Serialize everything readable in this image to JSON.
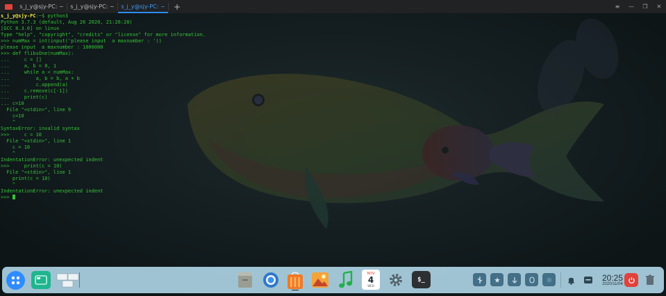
{
  "titlebar": {
    "tabs": [
      {
        "label": "s_j_y@sjy-PC: ~",
        "active": false
      },
      {
        "label": "s_j_y@sjy-PC: ~",
        "active": false
      },
      {
        "label": "s_j_y@sjy-PC: ~",
        "active": true
      }
    ],
    "add_tab": "+",
    "menu_icon": "≡",
    "minimize_icon": "—",
    "maximize_icon": "❐",
    "close_icon": "✕"
  },
  "terminal": {
    "prompt_user": "s_j_y@sjy-PC",
    "prompt_rest": ":~$ python3",
    "lines": [
      "Python 3.7.3 (default, Aug 26 2020, 21:26:28)",
      "[GCC 8.3.0] on linux",
      "Type \"help\", \"copyright\", \"credits\" or \"license\" for more information.",
      ">>> numMax = int(input('please input  a maxnumber : '))",
      "please input  a maxnumber : 1000000",
      ">>> def flibsOne(numMax):",
      "...     c = []",
      "...     a, b = 0, 1",
      "...     while a < numMax:",
      "...         a, b = b, a + b",
      "...         c.append(a)",
      "...     c.remove(c[-1])",
      "...     print(c)",
      "... c=10",
      "  File \"<stdin>\", line 9",
      "    c=10",
      "    ^",
      "SyntaxError: invalid syntax",
      ">>>     c = 10",
      "  File \"<stdin>\", line 1",
      "    c = 10",
      "    ^",
      "IndentationError: unexpected indent",
      ">>>     print(c = 10)",
      "  File \"<stdin>\", line 1",
      "    print(c = 10)",
      "    ^",
      "IndentationError: unexpected indent"
    ],
    "last_prompt": ">>> "
  },
  "dock": {
    "calendar_month": "NOV",
    "calendar_day": "4",
    "calendar_weekday": "WED",
    "terminal_glyph": "$_",
    "clock_time": "20:25",
    "clock_date": "2020/11/04",
    "accent_colors": {
      "launcher": "#2f8cff",
      "multitask": "#1fb58f",
      "power": "#e0433b"
    }
  }
}
